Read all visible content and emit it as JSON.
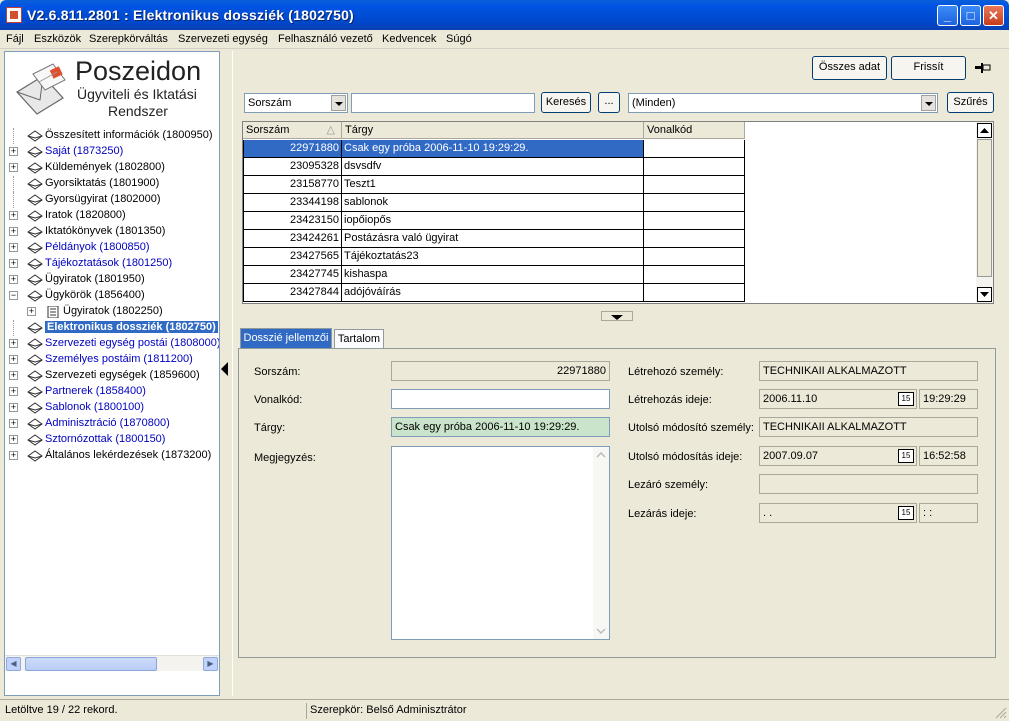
{
  "window": {
    "title": "V2.6.811.2801 : Elektronikus dossziék (1802750)",
    "buttons": {
      "minimize": "_",
      "maximize": "□",
      "close": "✕"
    }
  },
  "menu": [
    "Fájl",
    "Eszközök",
    "Szerepkörváltás",
    "Szervezeti egység",
    "Felhasználó vezető",
    "Kedvencek",
    "Súgó"
  ],
  "logo": {
    "title": "Poszeidon",
    "subtitle1": "Ügyviteli és Iktatási",
    "subtitle2": "Rendszer"
  },
  "tree": [
    {
      "label": "Összesített információk (1800950)",
      "blue": false,
      "expander": false
    },
    {
      "label": "Saját (1873250)",
      "blue": true,
      "expander": true
    },
    {
      "label": "Küldemények (1802800)",
      "blue": false,
      "expander": true
    },
    {
      "label": "Gyorsiktatás (1801900)",
      "blue": false,
      "expander": false
    },
    {
      "label": "Gyorsügyirat (1802000)",
      "blue": false,
      "expander": false
    },
    {
      "label": "Iratok (1820800)",
      "blue": false,
      "expander": true
    },
    {
      "label": "Iktatókönyvek (1801350)",
      "blue": false,
      "expander": true
    },
    {
      "label": "Példányok (1800850)",
      "blue": true,
      "expander": true
    },
    {
      "label": "Tájékoztatások (1801250)",
      "blue": true,
      "expander": true
    },
    {
      "label": "Ügyiratok (1801950)",
      "blue": false,
      "expander": true
    },
    {
      "label": "Ügykörök (1856400)",
      "blue": false,
      "expander": "minus"
    },
    {
      "label": "Ügyiratok (1802250)",
      "blue": false,
      "expander": true,
      "child": true
    },
    {
      "label": "Elektronikus dossziék (1802750)",
      "blue": false,
      "expander": false,
      "selected": true
    },
    {
      "label": "Szervezeti egység postái (1808000)",
      "blue": true,
      "expander": true
    },
    {
      "label": "Személyes postáim (1811200)",
      "blue": true,
      "expander": true
    },
    {
      "label": "Szervezeti egységek (1859600)",
      "blue": false,
      "expander": true
    },
    {
      "label": "Partnerek (1858400)",
      "blue": true,
      "expander": true
    },
    {
      "label": "Sablonok (1800100)",
      "blue": true,
      "expander": true
    },
    {
      "label": "Adminisztráció (1870800)",
      "blue": true,
      "expander": true
    },
    {
      "label": "Sztornózottak (1800150)",
      "blue": true,
      "expander": true
    },
    {
      "label": "Általános lekérdezések (1873200)",
      "blue": false,
      "expander": true
    }
  ],
  "toolbar": {
    "all_data": "Összes adat",
    "refresh": "Frissít",
    "search_field": "Sorszám",
    "search_value": "",
    "search_button": "Keresés",
    "ellipsis_button": "...",
    "filter_value": "(Minden)",
    "filter_button": "Szűrés"
  },
  "grid": {
    "columns": [
      "Sorszám",
      "Tárgy",
      "Vonalkód"
    ],
    "rows": [
      {
        "id": "22971880",
        "subject": "Csak egy próba 2006-11-10 19:29:29.",
        "barcode": "",
        "selected": true
      },
      {
        "id": "23095328",
        "subject": "dsvsdfv",
        "barcode": ""
      },
      {
        "id": "23158770",
        "subject": "Teszt1",
        "barcode": ""
      },
      {
        "id": "23344198",
        "subject": "sablonok",
        "barcode": ""
      },
      {
        "id": "23423150",
        "subject": "iopőiopős",
        "barcode": ""
      },
      {
        "id": "23424261",
        "subject": "Postázásra való ügyirat",
        "barcode": ""
      },
      {
        "id": "23427565",
        "subject": "Tájékoztatás23",
        "barcode": ""
      },
      {
        "id": "23427745",
        "subject": "kishaspa",
        "barcode": ""
      },
      {
        "id": "23427844",
        "subject": "adójóváírás",
        "barcode": ""
      }
    ]
  },
  "tabs": [
    "Dosszié jellemzői",
    "Tartalom"
  ],
  "details": {
    "sorszam_label": "Sorszám:",
    "sorszam_value": "22971880",
    "vonalkod_label": "Vonalkód:",
    "vonalkod_value": "",
    "targy_label": "Tárgy:",
    "targy_value": "Csak egy próba 2006-11-10 19:29:29.",
    "megjegyzes_label": "Megjegyzés:",
    "megjegyzes_value": "",
    "letrehozo_label": "Létrehozó személy:",
    "letrehozo_value": "TECHNIKAII ALKALMAZOTT",
    "letrehozas_label": "Létrehozás ideje:",
    "letrehozas_date": "2006.11.10",
    "letrehozas_time": "19:29:29",
    "modosito_label": "Utolsó módosító személy:",
    "modosito_value": "TECHNIKAII ALKALMAZOTT",
    "modositas_label": "Utolsó módosítás ideje:",
    "modositas_date": "2007.09.07",
    "modositas_time": "16:52:58",
    "lezaro_label": "Lezáró személy:",
    "lezaro_value": "",
    "lezaras_label": "Lezárás ideje:",
    "lezaras_date": " .  .",
    "lezaras_time": " :  :",
    "cal_glyph": "15"
  },
  "status": {
    "records": "Letöltve 19 / 22 rekord.",
    "role": "Szerepkör: Belső Adminisztrátor"
  },
  "colors": {
    "selection": "#316ac5",
    "titlebar": "#0054e3",
    "link_blue": "#0000c0"
  }
}
